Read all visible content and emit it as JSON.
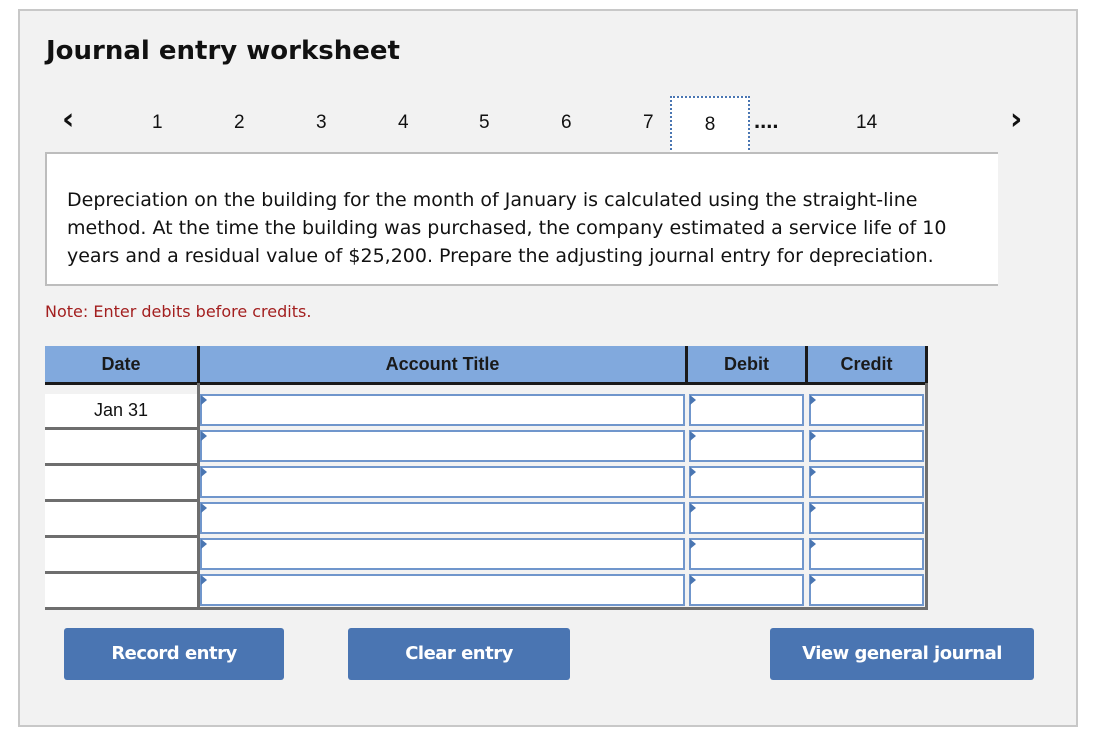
{
  "title": "Journal entry worksheet",
  "pager": {
    "prev_icon": "chevron-left-icon",
    "next_icon": "chevron-right-icon",
    "pages": [
      "1",
      "2",
      "3",
      "4",
      "5",
      "6",
      "7",
      "8"
    ],
    "active_page": "8",
    "ellipsis": "....",
    "last_page": "14"
  },
  "question": "Depreciation on the building for the month of January is calculated using the straight-line method. At the time the building was purchased, the company estimated a service life of 10 years and a residual value of $25,200. Prepare the adjusting journal entry for depreciation.",
  "note": "Note: Enter debits before credits.",
  "table": {
    "headers": [
      "Date",
      "Account Title",
      "Debit",
      "Credit"
    ],
    "rows": [
      {
        "date": "Jan 31",
        "account": "",
        "debit": "",
        "credit": ""
      },
      {
        "date": "",
        "account": "",
        "debit": "",
        "credit": ""
      },
      {
        "date": "",
        "account": "",
        "debit": "",
        "credit": ""
      },
      {
        "date": "",
        "account": "",
        "debit": "",
        "credit": ""
      },
      {
        "date": "",
        "account": "",
        "debit": "",
        "credit": ""
      },
      {
        "date": "",
        "account": "",
        "debit": "",
        "credit": ""
      }
    ]
  },
  "buttons": {
    "record": "Record entry",
    "clear": "Clear entry",
    "view": "View general journal"
  }
}
